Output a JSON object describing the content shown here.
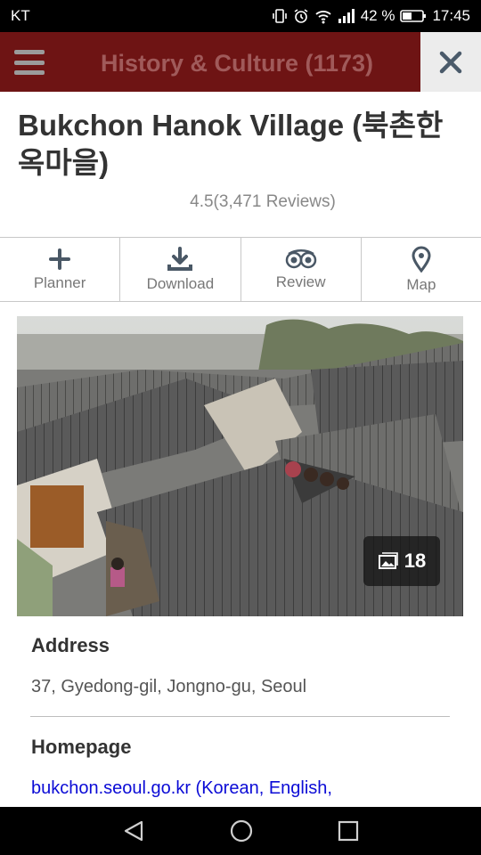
{
  "status_bar": {
    "carrier": "KT",
    "battery": "42 %",
    "time": "17:45"
  },
  "app_bar": {
    "title": "History & Culture (1173)"
  },
  "place": {
    "name": "Bukchon Hanok Village (북촌한옥마을)",
    "rating": "4.5(3,471 Reviews)"
  },
  "actions": [
    {
      "label": "Planner",
      "icon": "plus-icon"
    },
    {
      "label": "Download",
      "icon": "download-icon"
    },
    {
      "label": "Review",
      "icon": "tripadvisor-icon"
    },
    {
      "label": "Map",
      "icon": "map-pin-icon"
    }
  ],
  "photo": {
    "count": "18",
    "description": "Rooftops of traditional hanok houses"
  },
  "details": {
    "address_label": "Address",
    "address_value": "37, Gyedong-gil, Jongno-gu, Seoul",
    "homepage_label": "Homepage",
    "homepage_value": "bukchon.seoul.go.kr (Korean, English,"
  },
  "colors": {
    "app_bar": "#6e1414",
    "link": "#0b0bd6"
  }
}
